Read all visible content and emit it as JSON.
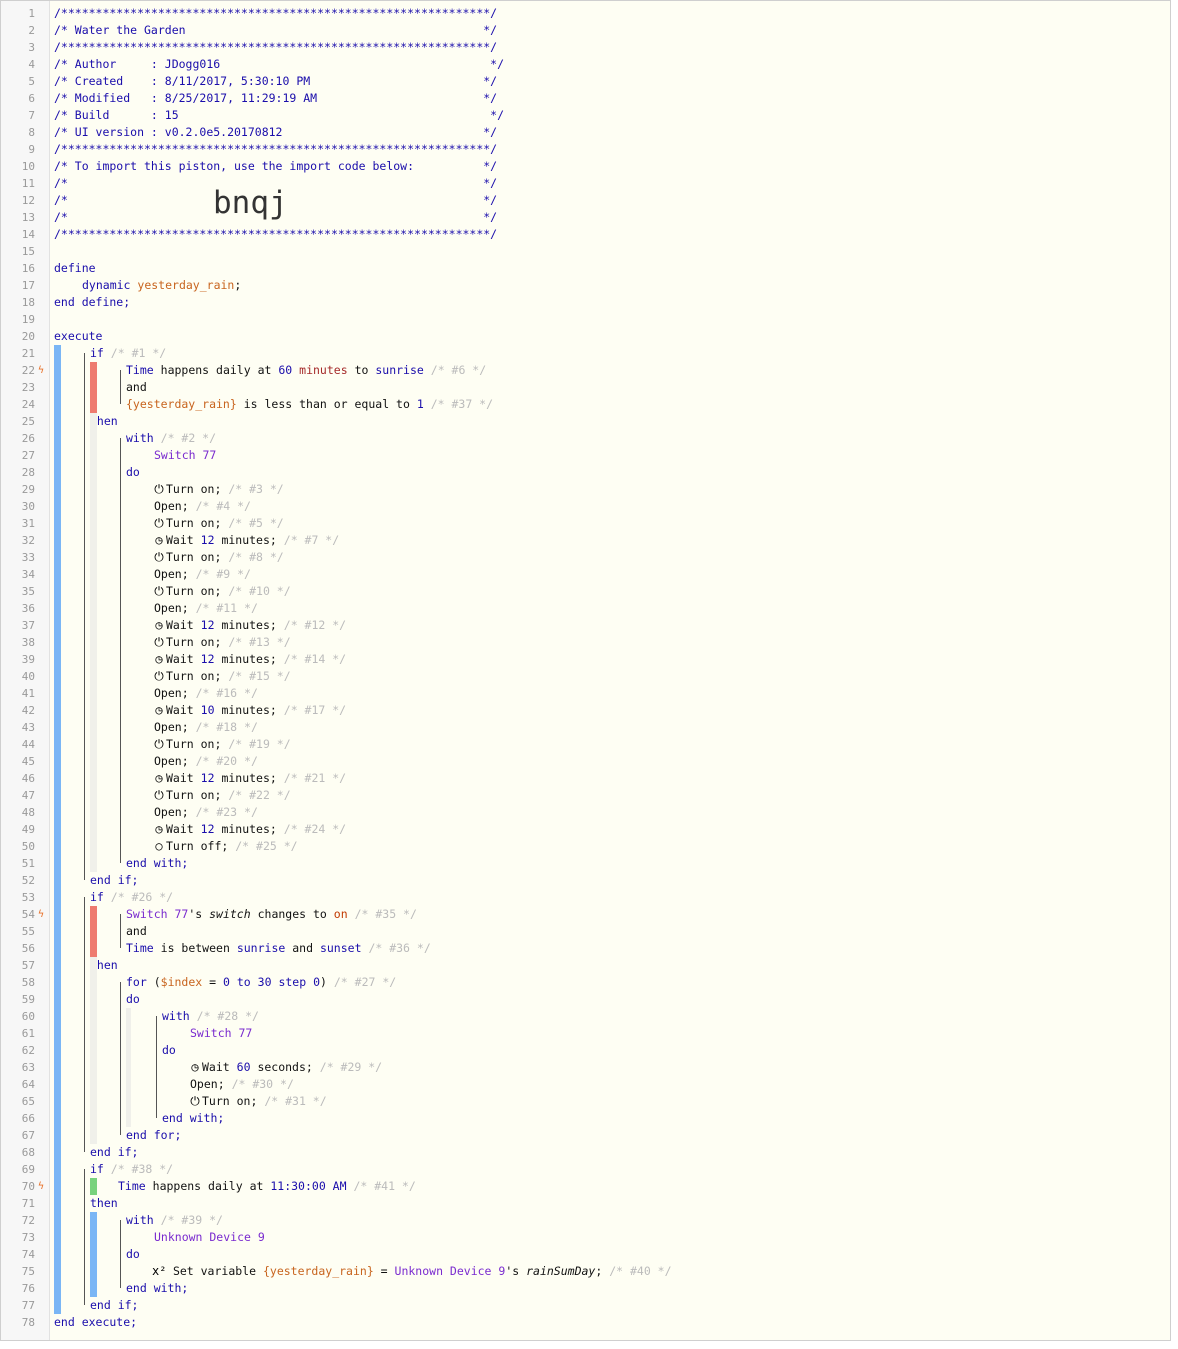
{
  "header": {
    "rule": "/**************************************************************/",
    "title": "/* Water the Garden                                           */",
    "author": "/* Author     : JDogg016                                       */",
    "created": "/* Created    : 8/11/2017, 5:30:10 PM                         */",
    "modified": "/* Modified   : 8/25/2017, 11:29:19 AM                        */",
    "build": "/* Build      : 15                                             */",
    "ui_version": "/* UI version : v0.2.0e5.20170812                             */",
    "import_text": "/* To import this piston, use the import code below:          */",
    "blank": "/*                                                            */",
    "import_code": "bnqj"
  },
  "code": {
    "define": "define",
    "dynamic": "dynamic",
    "var_name": "yesterday_rain",
    "end_define": "end define;",
    "execute": "execute",
    "end_execute": "end execute;",
    "if": "if",
    "then": "then",
    "and": "and",
    "end_if": "end if;",
    "with": "with",
    "do": "do",
    "end_with": "end with;",
    "end_for": "end for;",
    "c1": "/* #1 */",
    "c6": "/* #6 */",
    "c37": "/* #37 */",
    "c2": "/* #2 */",
    "time": "Time",
    "happens_daily_at": "happens daily at",
    "sixty": "60",
    "minutes_to": "minutes",
    "to": "to",
    "sunrise": "sunrise",
    "yr_var": "{yesterday_rain}",
    "lte": "is less than or equal to",
    "one": "1",
    "switch77": "Switch 77",
    "c26": "/* #26 */",
    "switch77s": "Switch 77",
    "apos_s": "'s",
    "switch_attr": "switch",
    "changes_to": "changes to",
    "on": "on",
    "c35": "/* #35 */",
    "is_between": "is between",
    "sunset": "sunset",
    "c36": "/* #36 */",
    "for": "for",
    "index": "$index",
    "zero": "0",
    "thirty": "30",
    "step": "step",
    "c27": "/* #27 */",
    "c28": "/* #28 */",
    "c38": "/* #38 */",
    "time_1130": "11:30:00 AM",
    "c41": "/* #41 */",
    "c39": "/* #39 */",
    "unknown_device": "Unknown Device 9",
    "set_variable": "Set variable",
    "rain_attr": "rainSumDay",
    "c40": "/* #40 */"
  },
  "tasks": [
    {
      "icon": "power-icon",
      "text": "Turn on;",
      "c": "/* #3 */"
    },
    {
      "icon": "",
      "text": "Open;",
      "c": "/* #4 */"
    },
    {
      "icon": "power-icon",
      "text": "Turn on;",
      "c": "/* #5 */"
    },
    {
      "icon": "clock-icon",
      "text": "Wait",
      "num": "12",
      "unit": "minutes;",
      "c": "/* #7 */"
    },
    {
      "icon": "power-icon",
      "text": "Turn on;",
      "c": "/* #8 */"
    },
    {
      "icon": "",
      "text": "Open;",
      "c": "/* #9 */"
    },
    {
      "icon": "power-icon",
      "text": "Turn on;",
      "c": "/* #10 */"
    },
    {
      "icon": "",
      "text": "Open;",
      "c": "/* #11 */"
    },
    {
      "icon": "clock-icon",
      "text": "Wait",
      "num": "12",
      "unit": "minutes;",
      "c": "/* #12 */"
    },
    {
      "icon": "power-icon",
      "text": "Turn on;",
      "c": "/* #13 */"
    },
    {
      "icon": "clock-icon",
      "text": "Wait",
      "num": "12",
      "unit": "minutes;",
      "c": "/* #14 */"
    },
    {
      "icon": "power-icon",
      "text": "Turn on;",
      "c": "/* #15 */"
    },
    {
      "icon": "",
      "text": "Open;",
      "c": "/* #16 */"
    },
    {
      "icon": "clock-icon",
      "text": "Wait",
      "num": "10",
      "unit": "minutes;",
      "c": "/* #17 */"
    },
    {
      "icon": "",
      "text": "Open;",
      "c": "/* #18 */"
    },
    {
      "icon": "power-icon",
      "text": "Turn on;",
      "c": "/* #19 */"
    },
    {
      "icon": "",
      "text": "Open;",
      "c": "/* #20 */"
    },
    {
      "icon": "clock-icon",
      "text": "Wait",
      "num": "12",
      "unit": "minutes;",
      "c": "/* #21 */"
    },
    {
      "icon": "power-icon",
      "text": "Turn on;",
      "c": "/* #22 */"
    },
    {
      "icon": "",
      "text": "Open;",
      "c": "/* #23 */"
    },
    {
      "icon": "clock-icon",
      "text": "Wait",
      "num": "12",
      "unit": "minutes;",
      "c": "/* #24 */"
    },
    {
      "icon": "circle-icon",
      "text": "Turn off;",
      "c": "/* #25 */"
    }
  ],
  "loop_tasks": [
    {
      "icon": "clock-icon",
      "text": "Wait",
      "num": "60",
      "unit": "seconds;",
      "c": "/* #29 */"
    },
    {
      "icon": "",
      "text": "Open;",
      "c": "/* #30 */"
    },
    {
      "icon": "power-icon",
      "text": "Turn on;",
      "c": "/* #31 */"
    }
  ],
  "icons": {
    "power-icon": "⏻",
    "clock-icon": "◷",
    "circle-icon": "○",
    "fx-icon": "x²",
    "flag-icon": "ϟ"
  },
  "colors": {
    "blue_bar": "#7ab6f5",
    "red_bar": "#ee7b6f",
    "green_bar": "#79d27d"
  }
}
